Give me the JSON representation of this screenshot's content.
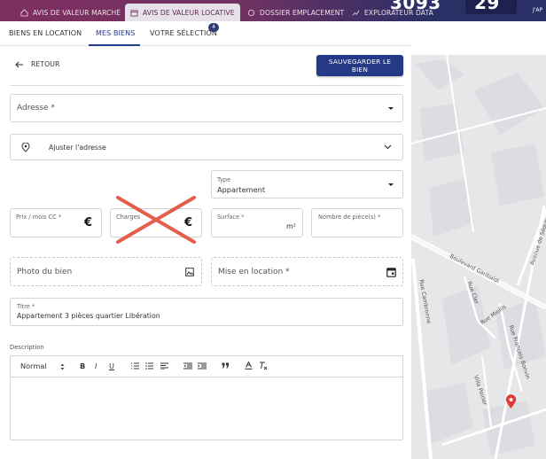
{
  "nav": {
    "tabs": [
      {
        "label": "AVIS DE VALEUR MARCHÉ",
        "icon": "house-euro-icon"
      },
      {
        "label": "AVIS DE VALEUR LOCATIVE",
        "icon": "key-euro-icon",
        "active": true
      },
      {
        "label": "DOSSIER EMPLACEMENT",
        "icon": "document-icon"
      },
      {
        "label": "EXPLORATEUR DATA",
        "icon": "chart-line-icon"
      }
    ],
    "stat_number": "3093",
    "stat_number_2": "29",
    "stat_suffix": "J'AP"
  },
  "subtabs": {
    "items": [
      "BIENS EN LOCATION",
      "MES BIENS",
      "VOTRE SÉLECTION"
    ],
    "active_index": 1,
    "selection_count": "4"
  },
  "form": {
    "back_label": "RETOUR",
    "save_label": "SAUVEGARDER LE BIEN",
    "address_placeholder": "Adresse *",
    "adjust_address_label": "Ajuster l'adresse",
    "type_label": "Type",
    "type_value": "Appartement",
    "rent_label": "Prix / mois CC *",
    "charges_label": "Charges",
    "currency_symbol": "€",
    "surface_label": "Surface *",
    "surface_unit": "m²",
    "rooms_label": "Nombre de pièce(s) *",
    "photo_placeholder": "Photo du bien",
    "rental_date_placeholder": "Mise en location *",
    "title_label": "Titre *",
    "title_value": "Appartement 3 pièces quartier Libération",
    "description_label": "Description",
    "editor_format": "Normal",
    "editor_tools": [
      "B",
      "I",
      "U"
    ]
  },
  "map": {
    "streets": [
      "Boulevard Garibaldi",
      "Avenue de Ségur",
      "Rue Cambronne",
      "Rue Cler",
      "Rue Miollis",
      "Rue François Bonvin",
      "Villa Poirier"
    ]
  },
  "colors": {
    "primary": "#253a85",
    "accent": "#e53935",
    "nav_bg": "#2a2f66"
  }
}
